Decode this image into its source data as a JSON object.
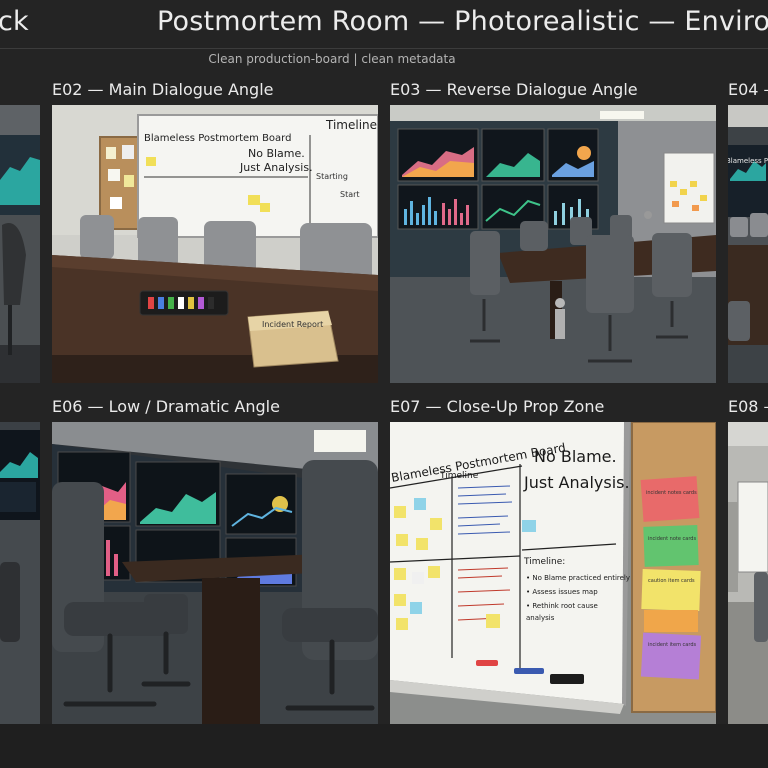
{
  "header": {
    "left_fragment": "ck",
    "title": "Postmortem Room — Photorealistic — Environn",
    "subtitle": "Clean production-board | clean metadata"
  },
  "shots": [
    {
      "label": "E02 — Main Dialogue Angle"
    },
    {
      "label": "E03 — Reverse Dialogue Angle"
    },
    {
      "label": "E04 —"
    },
    {
      "label": "E06 — Low / Dramatic Angle"
    },
    {
      "label": "E07 — Close-Up Prop Zone"
    },
    {
      "label": "E08 —"
    }
  ],
  "e02": {
    "board_title": "Blameless Postmortem Board",
    "board_heading": "Timeline",
    "board_quote_1": "No Blame.",
    "board_quote_2": "Just Analysis.",
    "board_note_1": "Starting",
    "board_note_2": "Start",
    "folder_label": "Incident Report"
  },
  "e04": {
    "board_fragment": "Blameless Pos"
  },
  "e07": {
    "board_title": "Blameless Postmortem Board",
    "timeline_heading": "Timeline",
    "quote_1": "No Blame.",
    "quote_2": "Just Analysis.",
    "timeline2_heading": "Timeline:",
    "item_1": "• No Blame practiced entirely",
    "item_2": "• Assess issues map",
    "item_3": "• Rethink root cause",
    "item_4": "  analysis",
    "card_1": "incident notes cards",
    "card_2": "incident note cards",
    "card_3": "caution item cards",
    "card_4": "incident item cards"
  },
  "colors": {
    "background": "#242424",
    "divider": "#3c3c3c",
    "accent_orange": "#f0a64a",
    "accent_yellow": "#f2e36a",
    "accent_green": "#62c46f",
    "accent_pink": "#e2568a",
    "accent_purple": "#b57fd6"
  }
}
